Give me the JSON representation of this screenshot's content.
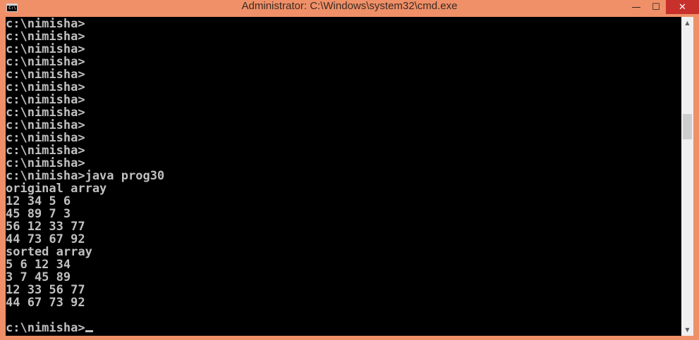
{
  "window": {
    "title": "Administrator: C:\\Windows\\system32\\cmd.exe",
    "icon": "cmd-icon",
    "icon_text": "C:\\",
    "controls": {
      "minimize": "—",
      "maximize": "☐",
      "close": "✕"
    }
  },
  "console": {
    "lines": [
      "c:\\nimisha>",
      "c:\\nimisha>",
      "c:\\nimisha>",
      "c:\\nimisha>",
      "c:\\nimisha>",
      "c:\\nimisha>",
      "c:\\nimisha>",
      "c:\\nimisha>",
      "c:\\nimisha>",
      "c:\\nimisha>",
      "c:\\nimisha>",
      "c:\\nimisha>",
      "c:\\nimisha>java prog30",
      "original array",
      "12 34 5 6",
      "45 89 7 3",
      "56 12 33 77",
      "44 73 67 92",
      "sorted array",
      "5 6 12 34",
      "3 7 45 89",
      "12 33 56 77",
      "44 67 73 92",
      "",
      "c:\\nimisha>"
    ],
    "text_color": "#c0c0c0",
    "background_color": "#000000"
  },
  "scrollbar": {
    "up_arrow": "▲",
    "down_arrow": "▼"
  },
  "colors": {
    "frame": "#ef9068",
    "close_button": "#c7302b"
  }
}
